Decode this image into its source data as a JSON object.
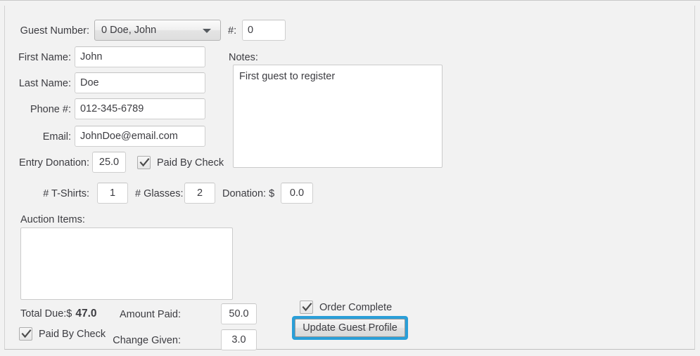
{
  "window": {
    "background_color": "#f2f2f2",
    "panel_border_color": "#d2d2d2"
  },
  "form": {
    "guest_number": {
      "label": "Guest Number:",
      "selected_option": "0 Doe, John",
      "options": [
        "0 Doe, John"
      ],
      "caret_icon": "chevron-down-icon"
    },
    "guest_index": {
      "label": "#:",
      "value": "0"
    },
    "first_name": {
      "label": "First Name:",
      "value": "John",
      "placeholder": ""
    },
    "last_name": {
      "label": "Last Name:",
      "value": "Doe",
      "placeholder": ""
    },
    "phone": {
      "label": "Phone #:",
      "value": "012-345-6789",
      "placeholder": ""
    },
    "email": {
      "label": "Email:",
      "value": "JohnDoe@email.com",
      "placeholder": ""
    },
    "notes": {
      "label": "Notes:",
      "value": "First guest to register",
      "placeholder": ""
    },
    "entry_donation": {
      "label": "Entry Donation:",
      "value": "25.0"
    },
    "entry_paid_by_check": {
      "label": "Paid By Check",
      "checked": true,
      "check_icon": "checkmark-icon"
    },
    "tshirts": {
      "label": "# T-Shirts:",
      "value": "1"
    },
    "glasses": {
      "label": "# Glasses:",
      "value": "2"
    },
    "donation": {
      "label": "Donation: $",
      "value": "0.0"
    },
    "auction_items": {
      "label": "Auction Items:",
      "items": []
    },
    "total_due": {
      "label": "Total Due:$",
      "amount": "47.0"
    },
    "total_paid_by_check": {
      "label": "Paid By Check",
      "checked": true,
      "check_icon": "checkmark-icon"
    },
    "amount_paid": {
      "label": "Amount Paid:",
      "value": "50.0"
    },
    "change_given": {
      "label": "Change Given:",
      "value": "3.0"
    },
    "order_complete": {
      "label": "Order Complete",
      "checked": true,
      "check_icon": "checkmark-icon"
    },
    "update_button": {
      "label": "Update Guest Profile",
      "focus_ring_color": "#2a9fd8"
    }
  }
}
